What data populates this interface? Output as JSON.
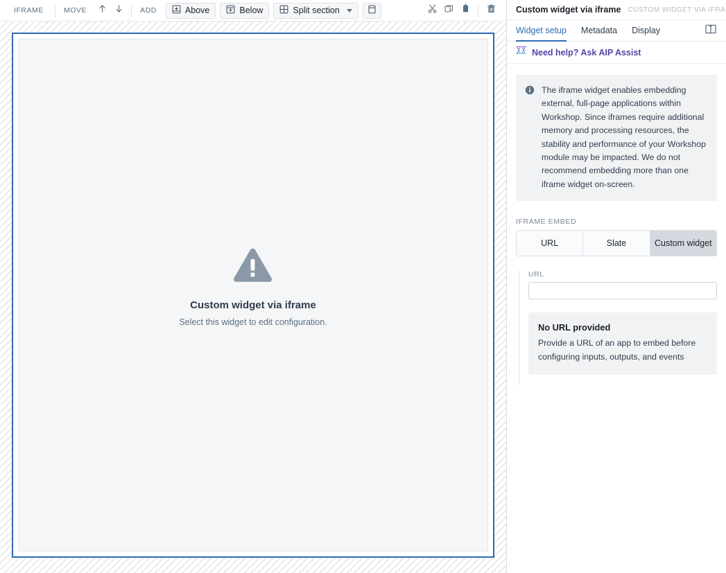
{
  "toolbar": {
    "widget_type_label": "IFRAME",
    "move_label": "MOVE",
    "move_up_icon": "arrow-up-icon",
    "move_down_icon": "arrow-down-icon",
    "add_label": "ADD",
    "add_above_label": "Above",
    "add_below_label": "Below",
    "split_section_label": "Split section",
    "split_caret_icon": "chevron-down-icon",
    "panel_layout_icon": "panel-layout-icon",
    "cut_icon": "scissors-icon",
    "copy_icon": "duplicate-icon",
    "paste_icon": "clipboard-icon",
    "delete_icon": "trash-icon"
  },
  "canvas": {
    "placeholder_icon": "warning-triangle-icon",
    "placeholder_title": "Custom widget via iframe",
    "placeholder_subtitle": "Select this widget to edit configuration.",
    "selection_color": "#2d6ab4"
  },
  "panel": {
    "title": "Custom widget via iframe",
    "subtitle": "CUSTOM WIDGET VIA IFRAME",
    "docs_icon": "book-icon",
    "tabs": [
      {
        "label": "Widget setup",
        "active": true
      },
      {
        "label": "Metadata",
        "active": false
      },
      {
        "label": "Display",
        "active": false
      }
    ],
    "active_tab_color": "#2d6ab4",
    "aip": {
      "icon": "aip-assist-icon",
      "label": "Need help? Ask AIP Assist",
      "color": "#5643a6"
    },
    "info_callout": {
      "icon": "info-icon",
      "text": "The iframe widget enables embedding external, full-page applications within Workshop. Since iframes require additional memory and processing resources, the stability and performance of your Workshop module may be impacted. We do not recommend embedding more than one iframe widget on-screen."
    },
    "iframe_embed": {
      "section_label": "IFRAME EMBED",
      "options": [
        {
          "label": "URL",
          "selected": false
        },
        {
          "label": "Slate",
          "selected": false
        },
        {
          "label": "Custom widget",
          "selected": true
        }
      ]
    },
    "url_field": {
      "label": "URL",
      "value": "",
      "placeholder": ""
    },
    "no_url_callout": {
      "title": "No URL provided",
      "text": "Provide a URL of an app to embed before configuring inputs, outputs, and events"
    }
  }
}
